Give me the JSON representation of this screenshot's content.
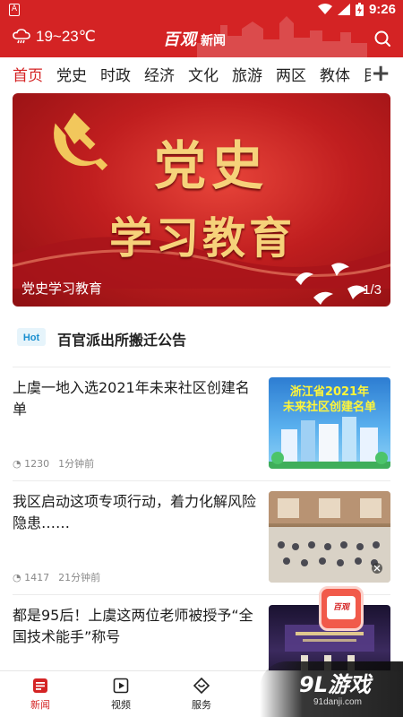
{
  "status_bar": {
    "time": "9:26",
    "indicator": "A",
    "icons": [
      "wifi-icon",
      "signal-icon",
      "battery-charging-icon"
    ]
  },
  "header": {
    "weather_text": "19~23℃",
    "weather_icon": "cloud-rain-icon",
    "logo_main": "百观",
    "logo_sub": "新闻",
    "search_icon": "search-icon",
    "brand_color": "#d42324"
  },
  "tabs": {
    "items": [
      "首页",
      "党史",
      "时政",
      "经济",
      "文化",
      "旅游",
      "两区",
      "教体",
      "民"
    ],
    "active_index": 0,
    "add_icon": "plus-icon"
  },
  "banner": {
    "headline_line1": "党史",
    "headline_line2": "学习教育",
    "caption": "党史学习教育",
    "pager": "1/3"
  },
  "notice": {
    "icon": "notice-icon",
    "text": "百官派出所搬迁公告"
  },
  "news": [
    {
      "title": "上虞一地入选2021年未来社区创建名单",
      "views": "1230",
      "time": "1分钟前",
      "thumb_text": "浙江省2021年\n未来社区创建名单"
    },
    {
      "title": "我区启动这项专项行动，着力化解风险隐患……",
      "views": "1417",
      "time": "21分钟前"
    },
    {
      "title": "都是95后！上虞这两位老师被授予“全国技术能手”称号"
    }
  ],
  "float_badge": {
    "text": "百观"
  },
  "bottom_nav": {
    "items": [
      {
        "label": "新闻",
        "icon": "news-icon",
        "active": true
      },
      {
        "label": "视频",
        "icon": "video-icon",
        "active": false
      },
      {
        "label": "服务",
        "icon": "service-icon",
        "active": false
      }
    ]
  },
  "watermark": {
    "main": "9L游戏",
    "sub": "91danji.com"
  }
}
